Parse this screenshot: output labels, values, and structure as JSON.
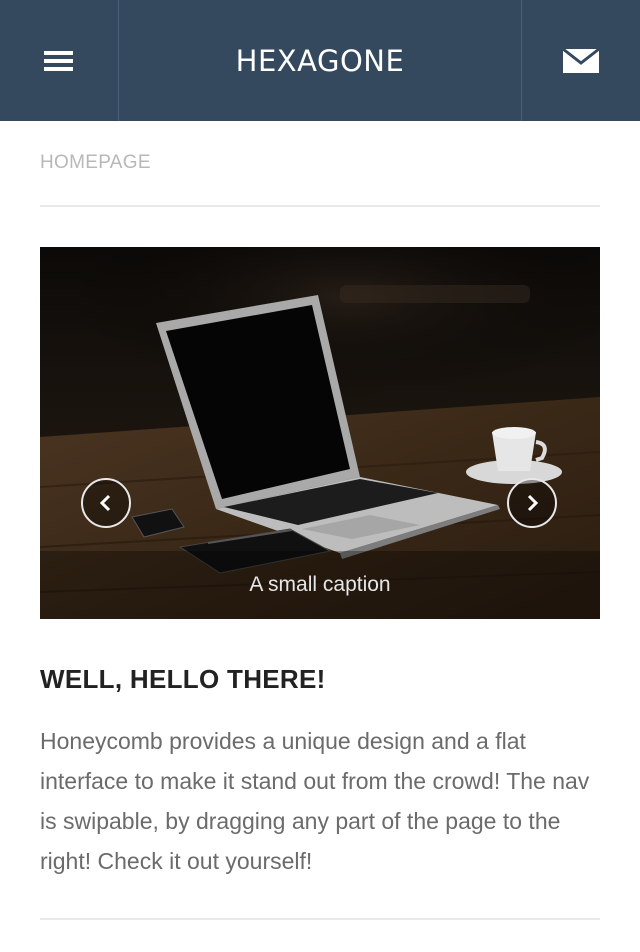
{
  "header": {
    "brand": "HEXAGONE",
    "menu_icon": "hamburger-menu-icon",
    "mail_icon": "envelope-icon",
    "background_color": "#34495e"
  },
  "breadcrumb": {
    "label": "HOMEPAGE"
  },
  "slider": {
    "caption": "A small caption",
    "prev_icon": "chevron-left-icon",
    "next_icon": "chevron-right-icon",
    "image_subject": "laptop on wooden desk"
  },
  "content": {
    "heading": "WELL, HELLO THERE!",
    "paragraph": "Honeycomb provides a unique design and a flat interface to make it stand out from the crowd! The nav is swipable, by dragging any part of the page to the right! Check it out yourself!"
  }
}
